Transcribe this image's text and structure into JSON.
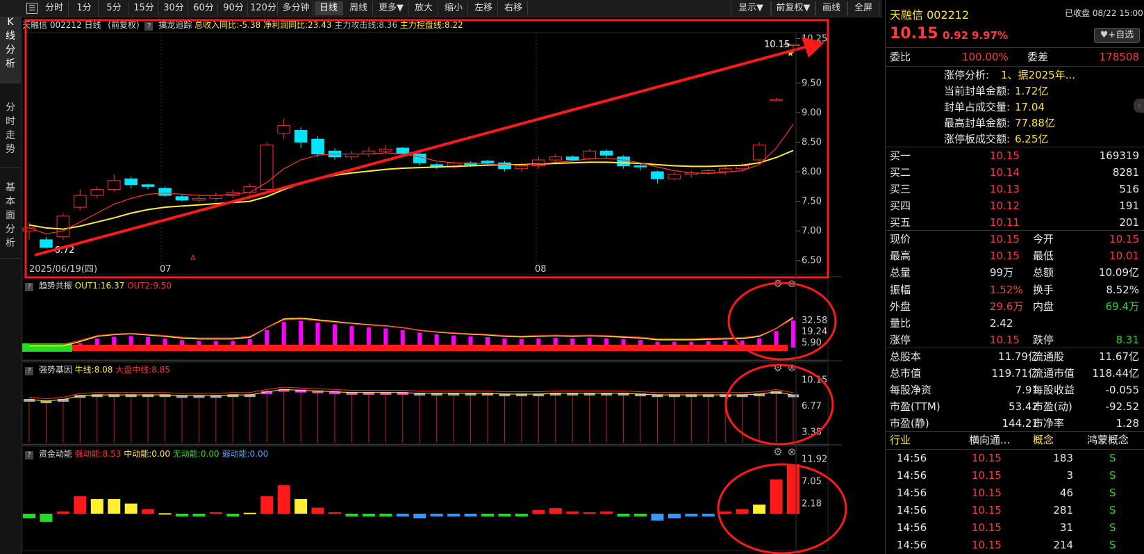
{
  "toolbar": {
    "menu_icon": "menu-icon",
    "buttons": [
      "分时",
      "1分",
      "5分",
      "15分",
      "30分",
      "60分",
      "90分",
      "120分",
      "多分钟",
      "日线",
      "周线",
      "更多▼",
      "放大",
      "缩小",
      "左移",
      "右移"
    ],
    "active": "日线",
    "right_buttons": [
      "显示▼",
      "前复权▼",
      "画线",
      "全屏"
    ]
  },
  "left_tabs": [
    {
      "label": "K\n线\n分\n析",
      "active": true
    },
    {
      "label": "分\n时\n走\n势",
      "active": false
    },
    {
      "label": "基\n本\n面\n分\n析",
      "active": false
    }
  ],
  "kline": {
    "header": {
      "title": "天融信 002212 日线",
      "mode": "(前复权)",
      "indicator": "擒龙追踪",
      "v1": "总收入同比:-5.38",
      "v2": "净利润同比:23.43",
      "v3": "主力攻击线:8.36",
      "v4": "主力控盘线:8.22"
    },
    "y_ticks": [
      "10.25",
      "9.50",
      "9.00",
      "8.50",
      "8.00",
      "7.50",
      "7.00",
      "6.50"
    ],
    "x_labels": [
      "2025/06/19(四)",
      "07",
      "08"
    ],
    "high_label": "10.15",
    "low_label": "6.72"
  },
  "ind1": {
    "name": "趋势共振",
    "v1": "OUT1:16.37",
    "v2": "OUT2:9.50",
    "y_ticks": [
      "32.58",
      "19.24",
      "5.90"
    ]
  },
  "ind2": {
    "name": "强势基因",
    "v1": "牛线:8.08",
    "v2": "大盘中线:8.85",
    "y_ticks": [
      "10.15",
      "6.77",
      "3.38"
    ]
  },
  "ind3": {
    "name": "资金动能",
    "v1": "强动能:8.53",
    "v2": "中动能:0.00",
    "v3": "无动能:0.00",
    "v4": "弱动能:0.00",
    "y_ticks": [
      "11.92",
      "7.05",
      "2.18"
    ]
  },
  "chart_data": {
    "type": "candlestick",
    "title": "天融信 002212 日线",
    "y_range": [
      6.45,
      10.35
    ],
    "candles": [
      [
        7.0,
        7.05,
        6.85,
        7.15
      ],
      [
        6.85,
        6.72,
        6.7,
        6.9
      ],
      [
        6.9,
        7.25,
        6.85,
        7.3
      ],
      [
        7.4,
        7.6,
        7.35,
        7.7
      ],
      [
        7.6,
        7.7,
        7.55,
        7.75
      ],
      [
        7.7,
        7.85,
        7.65,
        7.95
      ],
      [
        7.88,
        7.78,
        7.72,
        7.92
      ],
      [
        7.78,
        7.75,
        7.7,
        7.8
      ],
      [
        7.72,
        7.6,
        7.58,
        7.75
      ],
      [
        7.58,
        7.52,
        7.5,
        7.62
      ],
      [
        7.52,
        7.55,
        7.48,
        7.6
      ],
      [
        7.55,
        7.6,
        7.5,
        7.65
      ],
      [
        7.6,
        7.65,
        7.55,
        7.7
      ],
      [
        7.65,
        7.75,
        7.6,
        7.8
      ],
      [
        7.7,
        8.45,
        7.68,
        8.5
      ],
      [
        8.65,
        8.78,
        8.55,
        8.9
      ],
      [
        8.7,
        8.5,
        8.4,
        8.75
      ],
      [
        8.55,
        8.3,
        8.25,
        8.6
      ],
      [
        8.35,
        8.25,
        8.2,
        8.4
      ],
      [
        8.25,
        8.3,
        8.2,
        8.35
      ],
      [
        8.3,
        8.35,
        8.25,
        8.42
      ],
      [
        8.35,
        8.38,
        8.3,
        8.45
      ],
      [
        8.4,
        8.3,
        8.25,
        8.42
      ],
      [
        8.3,
        8.15,
        8.1,
        8.32
      ],
      [
        8.12,
        8.08,
        8.05,
        8.15
      ],
      [
        8.08,
        8.15,
        8.05,
        8.18
      ],
      [
        8.15,
        8.12,
        8.08,
        8.18
      ],
      [
        8.18,
        8.15,
        8.1,
        8.2
      ],
      [
        8.15,
        8.05,
        8.0,
        8.18
      ],
      [
        8.05,
        8.1,
        8.0,
        8.15
      ],
      [
        8.1,
        8.2,
        8.05,
        8.25
      ],
      [
        8.2,
        8.25,
        8.15,
        8.3
      ],
      [
        8.25,
        8.2,
        8.18,
        8.28
      ],
      [
        8.22,
        8.35,
        8.2,
        8.38
      ],
      [
        8.35,
        8.28,
        8.22,
        8.38
      ],
      [
        8.25,
        8.1,
        8.05,
        8.28
      ],
      [
        8.1,
        8.08,
        8.02,
        8.15
      ],
      [
        8.0,
        7.88,
        7.8,
        8.02
      ],
      [
        7.88,
        7.95,
        7.85,
        8.0
      ],
      [
        7.95,
        7.98,
        7.9,
        8.02
      ],
      [
        7.98,
        8.02,
        7.95,
        8.05
      ],
      [
        8.0,
        8.05,
        7.95,
        8.1
      ],
      [
        8.05,
        8.1,
        8.0,
        8.15
      ],
      [
        8.2,
        8.45,
        8.15,
        8.5
      ],
      [
        9.2,
        9.22,
        9.2,
        9.25
      ],
      [
        10.15,
        10.15,
        10.01,
        10.15
      ]
    ],
    "ma_short": [
      7.05,
      6.95,
      7.0,
      7.15,
      7.3,
      7.45,
      7.55,
      7.62,
      7.64,
      7.62,
      7.6,
      7.6,
      7.62,
      7.65,
      7.82,
      8.05,
      8.2,
      8.28,
      8.3,
      8.3,
      8.3,
      8.32,
      8.3,
      8.25,
      8.18,
      8.15,
      8.14,
      8.13,
      8.12,
      8.11,
      8.13,
      8.16,
      8.18,
      8.22,
      8.23,
      8.2,
      8.15,
      8.08,
      8.02,
      7.98,
      7.97,
      7.99,
      8.02,
      8.12,
      8.4,
      8.8
    ],
    "ma_long": [
      7.1,
      7.05,
      7.03,
      7.08,
      7.15,
      7.22,
      7.3,
      7.36,
      7.4,
      7.42,
      7.44,
      7.46,
      7.48,
      7.5,
      7.58,
      7.7,
      7.8,
      7.88,
      7.94,
      7.98,
      8.01,
      8.04,
      8.06,
      8.07,
      8.08,
      8.09,
      8.1,
      8.11,
      8.12,
      8.12,
      8.13,
      8.14,
      8.15,
      8.16,
      8.16,
      8.15,
      8.14,
      8.12,
      8.1,
      8.09,
      8.09,
      8.1,
      8.11,
      8.15,
      8.24,
      8.36
    ],
    "ind1_bars": [
      0,
      0,
      0,
      2.5,
      5.5,
      6.5,
      7.0,
      6.3,
      5.5,
      4.5,
      4.0,
      4.0,
      4.0,
      5.0,
      10.5,
      15.5,
      16.0,
      15.0,
      14.0,
      13.0,
      12.2,
      11.5,
      10.5,
      9.0,
      8.0,
      7.3,
      6.7,
      6.3,
      5.5,
      5.2,
      5.5,
      5.8,
      5.5,
      5.8,
      5.5,
      5.0,
      4.5,
      3.5,
      3.5,
      3.5,
      3.8,
      4.0,
      4.2,
      5.5,
      10.0,
      16.37
    ],
    "ind2_bars": [
      7.5,
      7.3,
      7.5,
      8.0,
      8.1,
      8.1,
      8.1,
      8.1,
      8.1,
      8.0,
      8.0,
      8.0,
      8.1,
      8.1,
      8.5,
      8.8,
      8.7,
      8.6,
      8.5,
      8.4,
      8.4,
      8.4,
      8.4,
      8.3,
      8.3,
      8.3,
      8.3,
      8.3,
      8.2,
      8.2,
      8.2,
      8.3,
      8.3,
      8.3,
      8.3,
      8.3,
      8.2,
      8.1,
      8.1,
      8.1,
      8.1,
      8.1,
      8.1,
      8.2,
      8.5,
      8.08
    ],
    "ind3_bars": [
      -1.0,
      -1.8,
      0.5,
      3.8,
      3.2,
      3.2,
      2.2,
      1.0,
      0.1,
      -0.6,
      -0.6,
      0.3,
      -0.6,
      0.2,
      3.8,
      6.2,
      3.2,
      1.3,
      0.3,
      -0.6,
      -0.6,
      -0.6,
      -0.6,
      -1.0,
      -0.6,
      -0.6,
      -0.6,
      -0.6,
      -0.6,
      -0.6,
      0.8,
      1.2,
      0.5,
      0.3,
      0.5,
      -0.6,
      -0.6,
      -1.5,
      -1.0,
      -0.6,
      -0.6,
      0.5,
      1.0,
      2.0,
      7.5,
      10.8
    ]
  },
  "quote": {
    "name_code": "天融信 002212",
    "status": "已收盘 08/22 15:00",
    "price": "10.15",
    "change": "0.92",
    "pct": "9.97%",
    "add_btn": "+自选",
    "webi_label": "委比",
    "webi_val": "100.00%",
    "weicha_label": "委差",
    "weicha_val": "178508",
    "limit_info": [
      {
        "label": "涨停分析:",
        "val": "1、据2025年..."
      },
      {
        "label": "当前封单金额:",
        "val": "1.72亿"
      },
      {
        "label": "封单占成交量:",
        "val": "17.04"
      },
      {
        "label": "最高封单金额:",
        "val": "77.88亿"
      },
      {
        "label": "涨停板成交额:",
        "val": "6.25亿"
      }
    ],
    "bids": [
      {
        "label": "买一",
        "price": "10.15",
        "vol": "169319"
      },
      {
        "label": "买二",
        "price": "10.14",
        "vol": "8281"
      },
      {
        "label": "买三",
        "price": "10.13",
        "vol": "516"
      },
      {
        "label": "买四",
        "price": "10.12",
        "vol": "191"
      },
      {
        "label": "买五",
        "price": "10.11",
        "vol": "201"
      }
    ],
    "stats": [
      {
        "l1": "现价",
        "v1": "10.15",
        "c1": "red",
        "l2": "今开",
        "v2": "10.15",
        "c2": "red"
      },
      {
        "l1": "最高",
        "v1": "10.15",
        "c1": "red",
        "l2": "最低",
        "v2": "10.01",
        "c2": "red"
      },
      {
        "l1": "总量",
        "v1": "99万",
        "c1": "white",
        "l2": "总额",
        "v2": "10.09亿",
        "c2": "white"
      },
      {
        "l1": "振幅",
        "v1": "1.52%",
        "c1": "red",
        "l2": "换手",
        "v2": "8.52%",
        "c2": "white"
      },
      {
        "l1": "外盘",
        "v1": "29.6万",
        "c1": "red",
        "l2": "内盘",
        "v2": "69.4万",
        "c2": "green"
      },
      {
        "l1": "量比",
        "v1": "2.42",
        "c1": "white",
        "l2": "",
        "v2": "",
        "c2": "white"
      },
      {
        "l1": "涨停",
        "v1": "10.15",
        "c1": "red",
        "l2": "跌停",
        "v2": "8.31",
        "c2": "green"
      }
    ],
    "fundamentals": [
      {
        "l1": "总股本",
        "v1": "11.79亿",
        "l2": "流通股",
        "v2": "11.67亿"
      },
      {
        "l1": "总市值",
        "v1": "119.71亿",
        "l2": "流通市值",
        "v2": "118.44亿"
      },
      {
        "l1": "每股净资",
        "v1": "7.91",
        "l2": "每股收益",
        "v2": "-0.055"
      },
      {
        "l1": "市盈(TTM)",
        "v1": "53.42",
        "l2": "市盈(动)",
        "v2": "-92.52"
      },
      {
        "l1": "市盈(静)",
        "v1": "144.21",
        "l2": "市净率",
        "v2": "1.28"
      }
    ],
    "tabs": [
      "行业",
      "横向通...",
      "概念",
      "鸿蒙概念"
    ],
    "ticks": [
      {
        "time": "14:56",
        "price": "10.15",
        "vol": "183",
        "side": "S"
      },
      {
        "time": "14:56",
        "price": "10.15",
        "vol": "3",
        "side": "S"
      },
      {
        "time": "14:56",
        "price": "10.15",
        "vol": "46",
        "side": "S"
      },
      {
        "time": "14:56",
        "price": "10.15",
        "vol": "281",
        "side": "S"
      },
      {
        "time": "14:56",
        "price": "10.15",
        "vol": "31",
        "side": "S"
      },
      {
        "time": "14:56",
        "price": "10.15",
        "vol": "214",
        "side": "S"
      }
    ]
  }
}
